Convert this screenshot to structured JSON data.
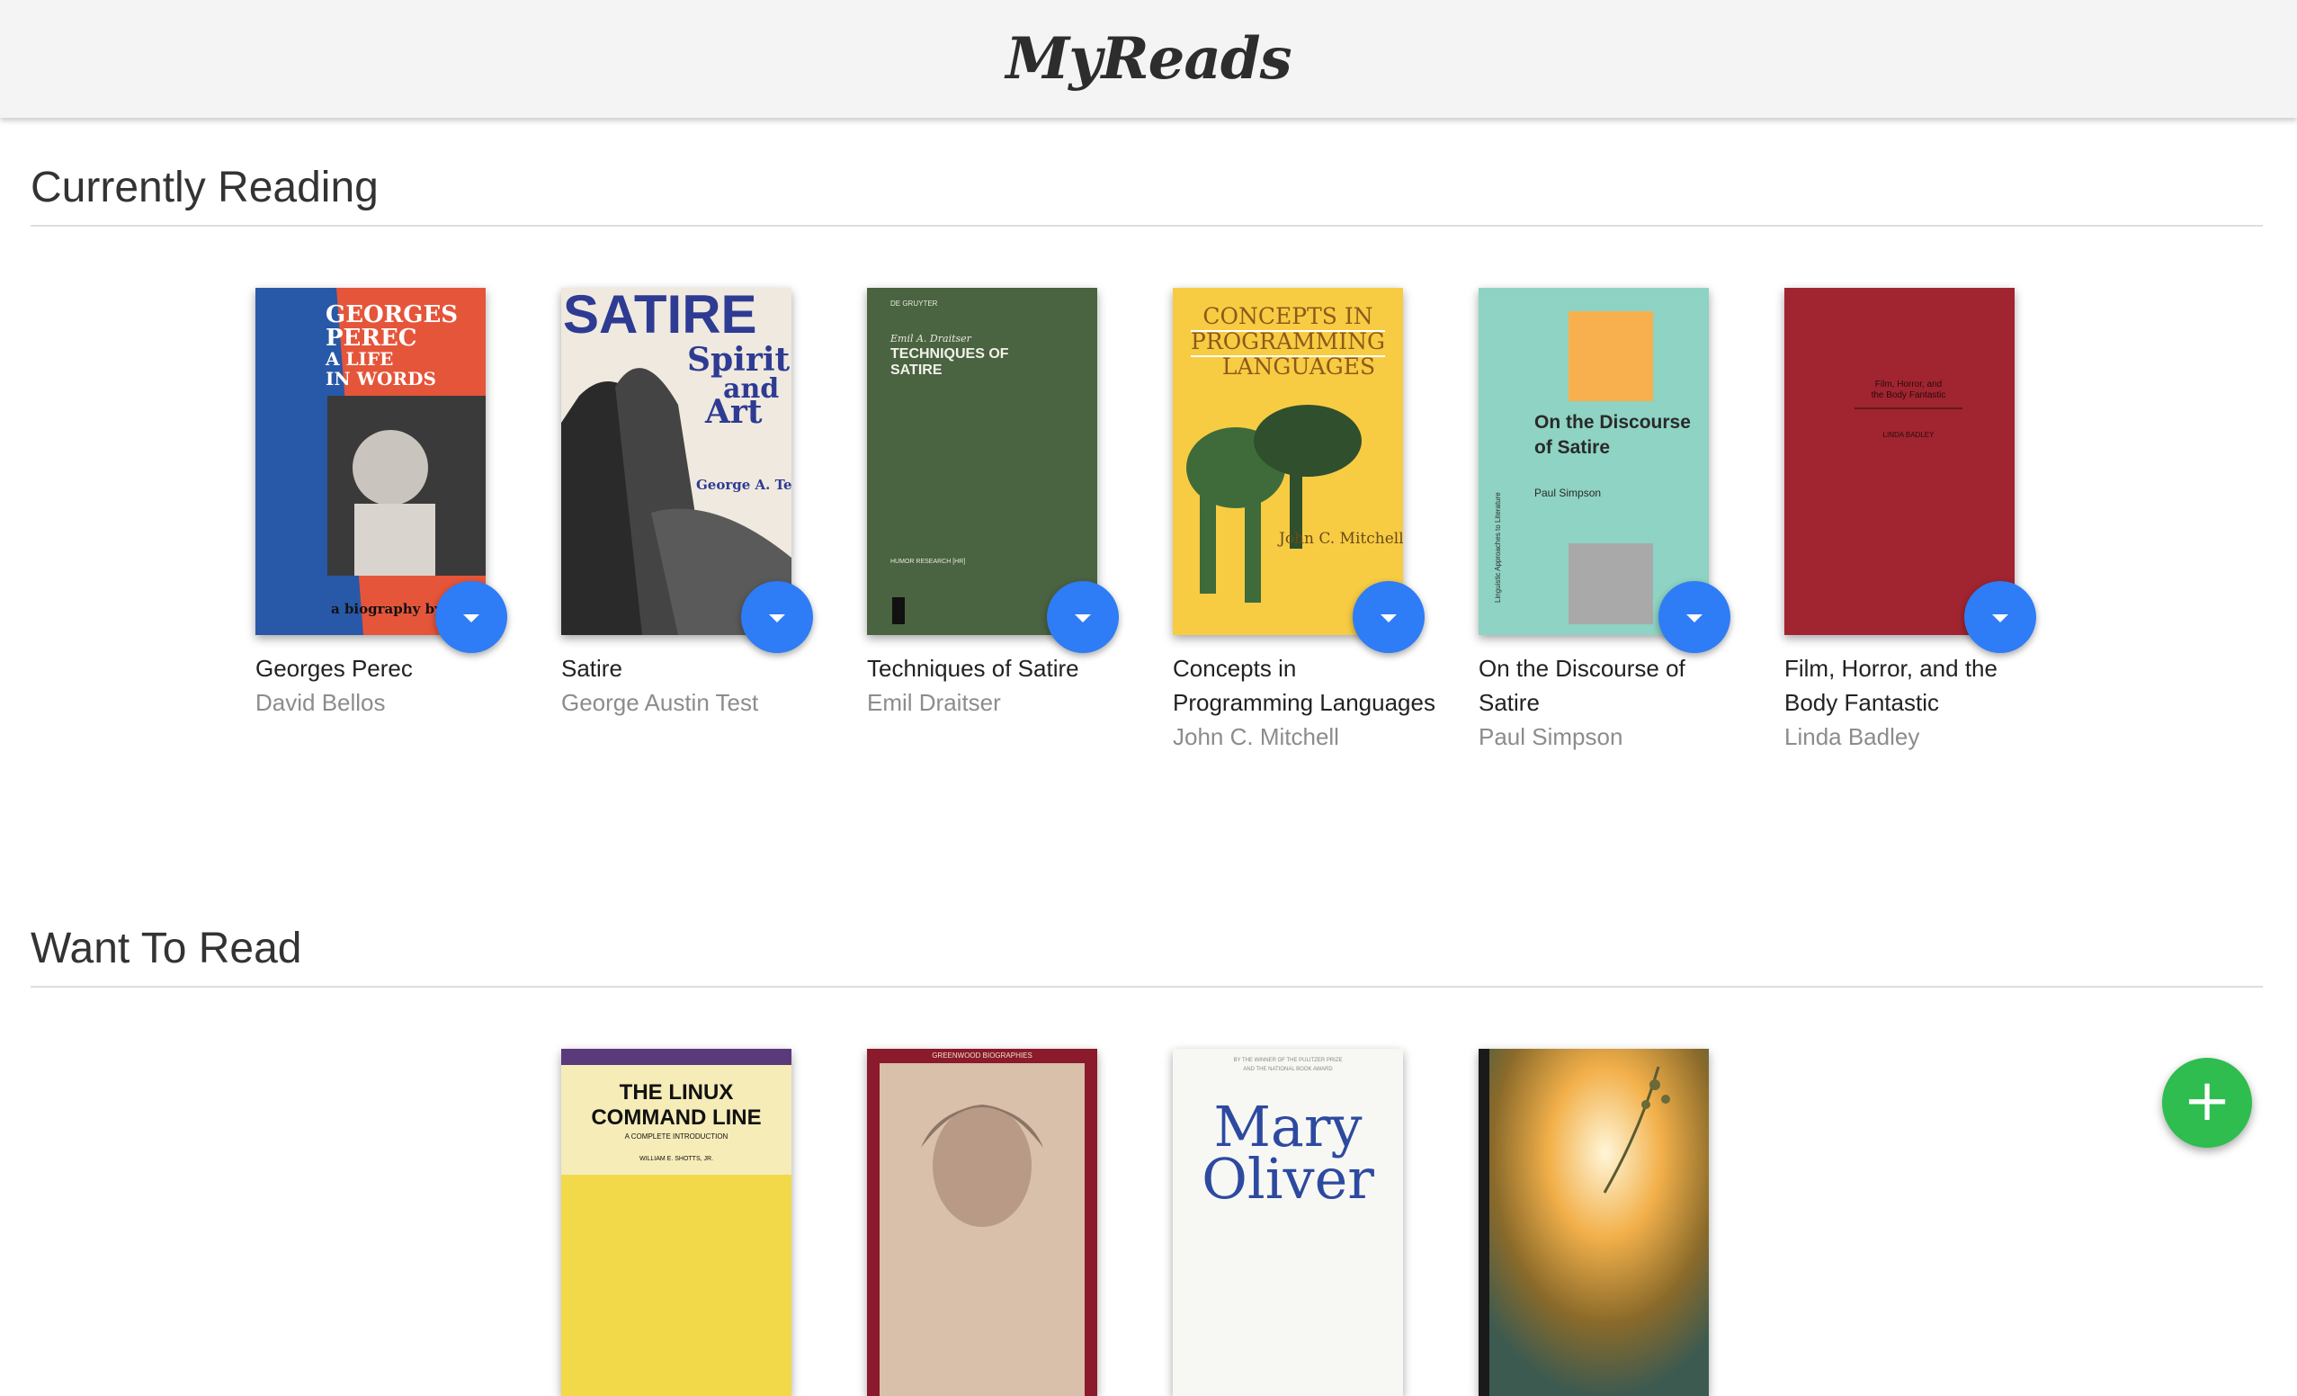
{
  "header": {
    "title": "MyReads"
  },
  "shelves": [
    {
      "title": "Currently Reading",
      "books": [
        {
          "title": "Georges Perec",
          "authors": "David Bellos",
          "cover": {
            "lines": [
              "GEORGES",
              "PEREC",
              "A LIFE",
              "IN WORDS"
            ],
            "footer": "a biography by DAVID BELLOS"
          }
        },
        {
          "title": "Satire",
          "authors": "George Austin Test",
          "cover": {
            "lines": [
              "SATIRE",
              "Spirit",
              "and",
              "Art"
            ],
            "footer": "George A. Test"
          }
        },
        {
          "title": "Techniques of Satire",
          "authors": "Emil Draitser",
          "cover": {
            "lines": [
              "DE GRUYTER",
              "Emil A. Draitser",
              "TECHNIQUES OF",
              "SATIRE"
            ],
            "footer": "HUMOR RESEARCH [HR]"
          }
        },
        {
          "title": "Concepts in Programming Languages",
          "authors": "John C. Mitchell",
          "cover": {
            "lines": [
              "CONCEPTS IN",
              "PROGRAMMING",
              "LANGUAGES"
            ],
            "footer": "John C. Mitchell"
          }
        },
        {
          "title": "On the Discourse of Satire",
          "authors": "Paul Simpson",
          "cover": {
            "lines": [
              "On the Discourse",
              "of Satire",
              "Paul Simpson"
            ],
            "footer": "Linguistic Approaches to Literature"
          }
        },
        {
          "title": "Film, Horror, and the Body Fantastic",
          "authors": "Linda Badley",
          "cover": {
            "lines": [
              "Film, Horror, and",
              "the Body Fantastic",
              "LINDA BADLEY"
            ],
            "footer": ""
          }
        }
      ]
    },
    {
      "title": "Want To Read",
      "books": [
        {
          "title": "",
          "authors": "",
          "cover": {
            "lines": [
              "THE LINUX",
              "COMMAND LINE",
              "A COMPLETE INTRODUCTION",
              "WILLIAM E. SHOTTS, JR."
            ],
            "footer": ""
          }
        },
        {
          "title": "",
          "authors": "",
          "cover": {
            "lines": [
              "GREENWOOD BIOGRAPHIES"
            ],
            "footer": ""
          }
        },
        {
          "title": "",
          "authors": "",
          "cover": {
            "lines": [
              "BY THE WINNER OF THE PULITZER PRIZE",
              "AND THE NATIONAL BOOK AWARD",
              "Mary",
              "Oliver"
            ],
            "footer": ""
          }
        },
        {
          "title": "",
          "authors": "",
          "cover": {
            "lines": [],
            "footer": ""
          }
        }
      ]
    }
  ],
  "actions": {
    "add_label": "+"
  },
  "icons": {
    "shelf_changer": "chevron-down-icon",
    "add": "plus-icon"
  },
  "colors": {
    "changer": "#2e7cf6",
    "add": "#2ebd4e",
    "header_bg": "#f4f4f4"
  }
}
